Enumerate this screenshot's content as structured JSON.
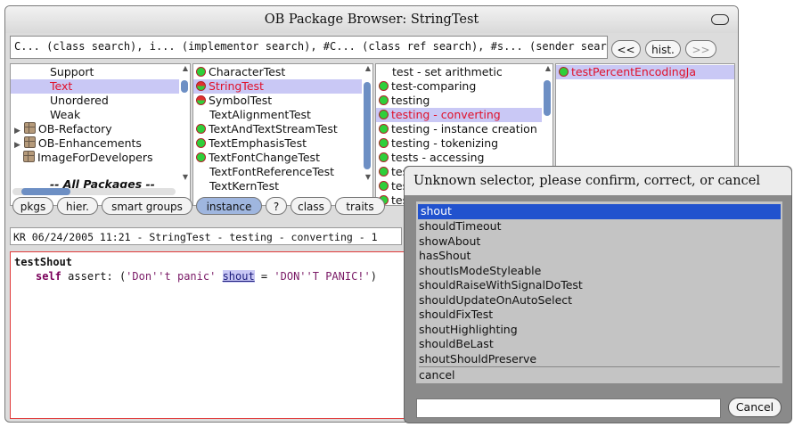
{
  "window": {
    "title": "OB Package Browser: StringTest"
  },
  "search": {
    "text": "C... (class search), i... (implementor search), #C... (class ref search), #s... (sender search)"
  },
  "nav": {
    "back": "<<",
    "history": "hist.",
    "forward": ">>"
  },
  "packages": [
    "Support",
    "Text",
    "Unordered",
    "Weak",
    "OB-Refactory",
    "OB-Enhancements",
    "ImageForDevelopers",
    "-- All Packages --"
  ],
  "classes": [
    "CharacterTest",
    "StringTest",
    "SymbolTest",
    "TextAlignmentTest",
    "TextAndTextStreamTest",
    "TextEmphasisTest",
    "TextFontChangeTest",
    "TextFontReferenceTest",
    "TextKernTest"
  ],
  "categories": [
    "test - set arithmetic",
    "test-comparing",
    "testing",
    "testing - converting",
    "testing - instance creation",
    "testing - tokenizing",
    "tests - accessing",
    "tests - ...",
    "tests - ...",
    "tests - ..."
  ],
  "methods": [
    "testPercentEncodingJa"
  ],
  "tabs": [
    "pkgs",
    "hier.",
    "smart groups",
    "instance",
    "?",
    "class",
    "traits"
  ],
  "status": "KR 06/24/2005 11:21 - StringTest - testing - converting - 1",
  "editor": {
    "method": "testShout",
    "self": "self",
    "assert": "assert: (",
    "str1": "'Don''t panic'",
    "shout": "shout",
    "eq": "=",
    "str2": "'DON''T PANIC!'",
    "close": ")"
  },
  "dialog": {
    "title": "Unknown selector, please confirm, correct, or cancel",
    "options": [
      "shout",
      "shouldTimeout",
      "showAbout",
      "hasShout",
      "shoutIsModeStyleable",
      "shouldRaiseWithSignalDoTest",
      "shouldUpdateOnAutoSelect",
      "shouldFixTest",
      "shoutHighlighting",
      "shouldBeLast",
      "shoutShouldPreserve"
    ],
    "cancel_option": "cancel",
    "input_value": "",
    "cancel_button": "Cancel"
  },
  "colors": {
    "selection": "#c9c8f5",
    "dialog_highlight": "#2152ce",
    "test_red": "#e0102a",
    "test_green": "#2fcf3a"
  }
}
